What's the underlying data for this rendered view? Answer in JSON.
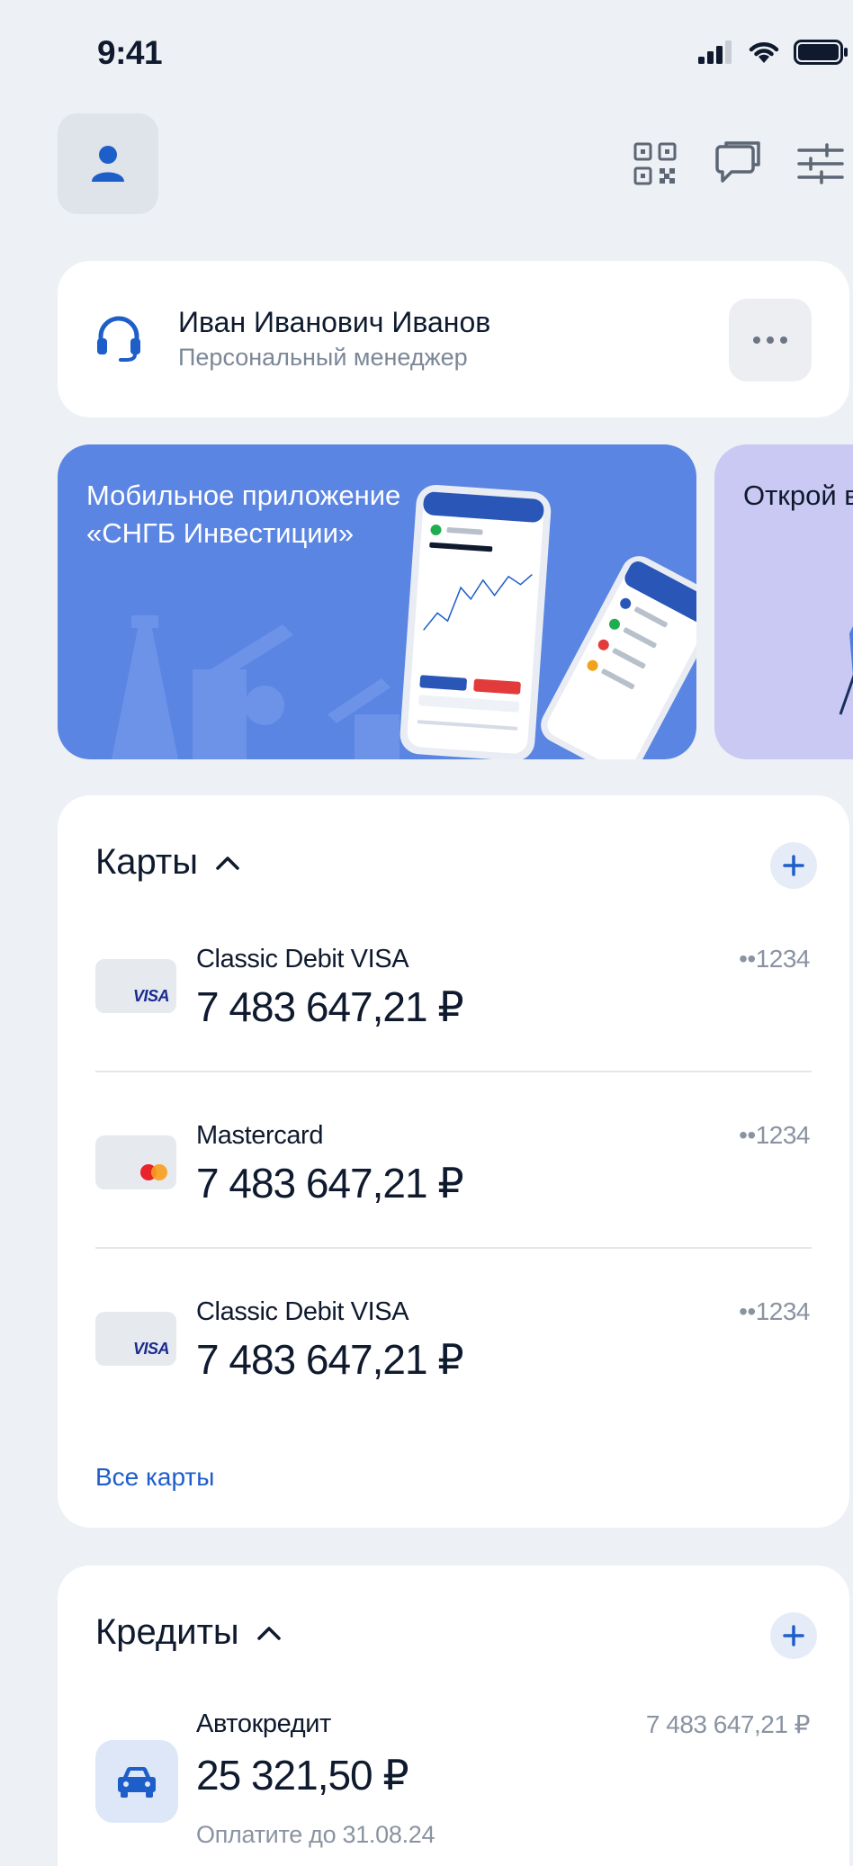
{
  "status_bar": {
    "time": "9:41"
  },
  "colors": {
    "accent": "#1e5ec9",
    "background": "#edf0f4",
    "banner_primary": "#5b85e3",
    "banner_secondary": "#c9c9f3"
  },
  "toolbar": {
    "icons": [
      "profile-icon",
      "qr-code-icon",
      "chat-icon",
      "filters-icon"
    ]
  },
  "manager": {
    "name": "Иван Иванович Иванов",
    "role": "Персональный менеджер"
  },
  "banners": [
    {
      "text": "Мобильное приложение «СНГБ Инвестиции»"
    },
    {
      "text": "Открой вклад п годовых"
    }
  ],
  "cards_section": {
    "title": "Карты",
    "items": [
      {
        "name": "Classic Debit VISA",
        "amount": "7 483 647,21 ₽",
        "mask": "••1234",
        "brand": "VISA"
      },
      {
        "name": "Mastercard",
        "amount": "7 483 647,21 ₽",
        "mask": "••1234",
        "brand": "mastercard"
      },
      {
        "name": "Classic Debit VISA",
        "amount": "7 483 647,21 ₽",
        "mask": "••1234",
        "brand": "VISA"
      }
    ],
    "all_link": "Все карты"
  },
  "credits_section": {
    "title": "Кредиты",
    "items": [
      {
        "name": "Автокредит",
        "amount": "25 321,50 ₽",
        "total": "7 483 647,21 ₽",
        "due": "Оплатите до 31.08.24"
      }
    ]
  }
}
